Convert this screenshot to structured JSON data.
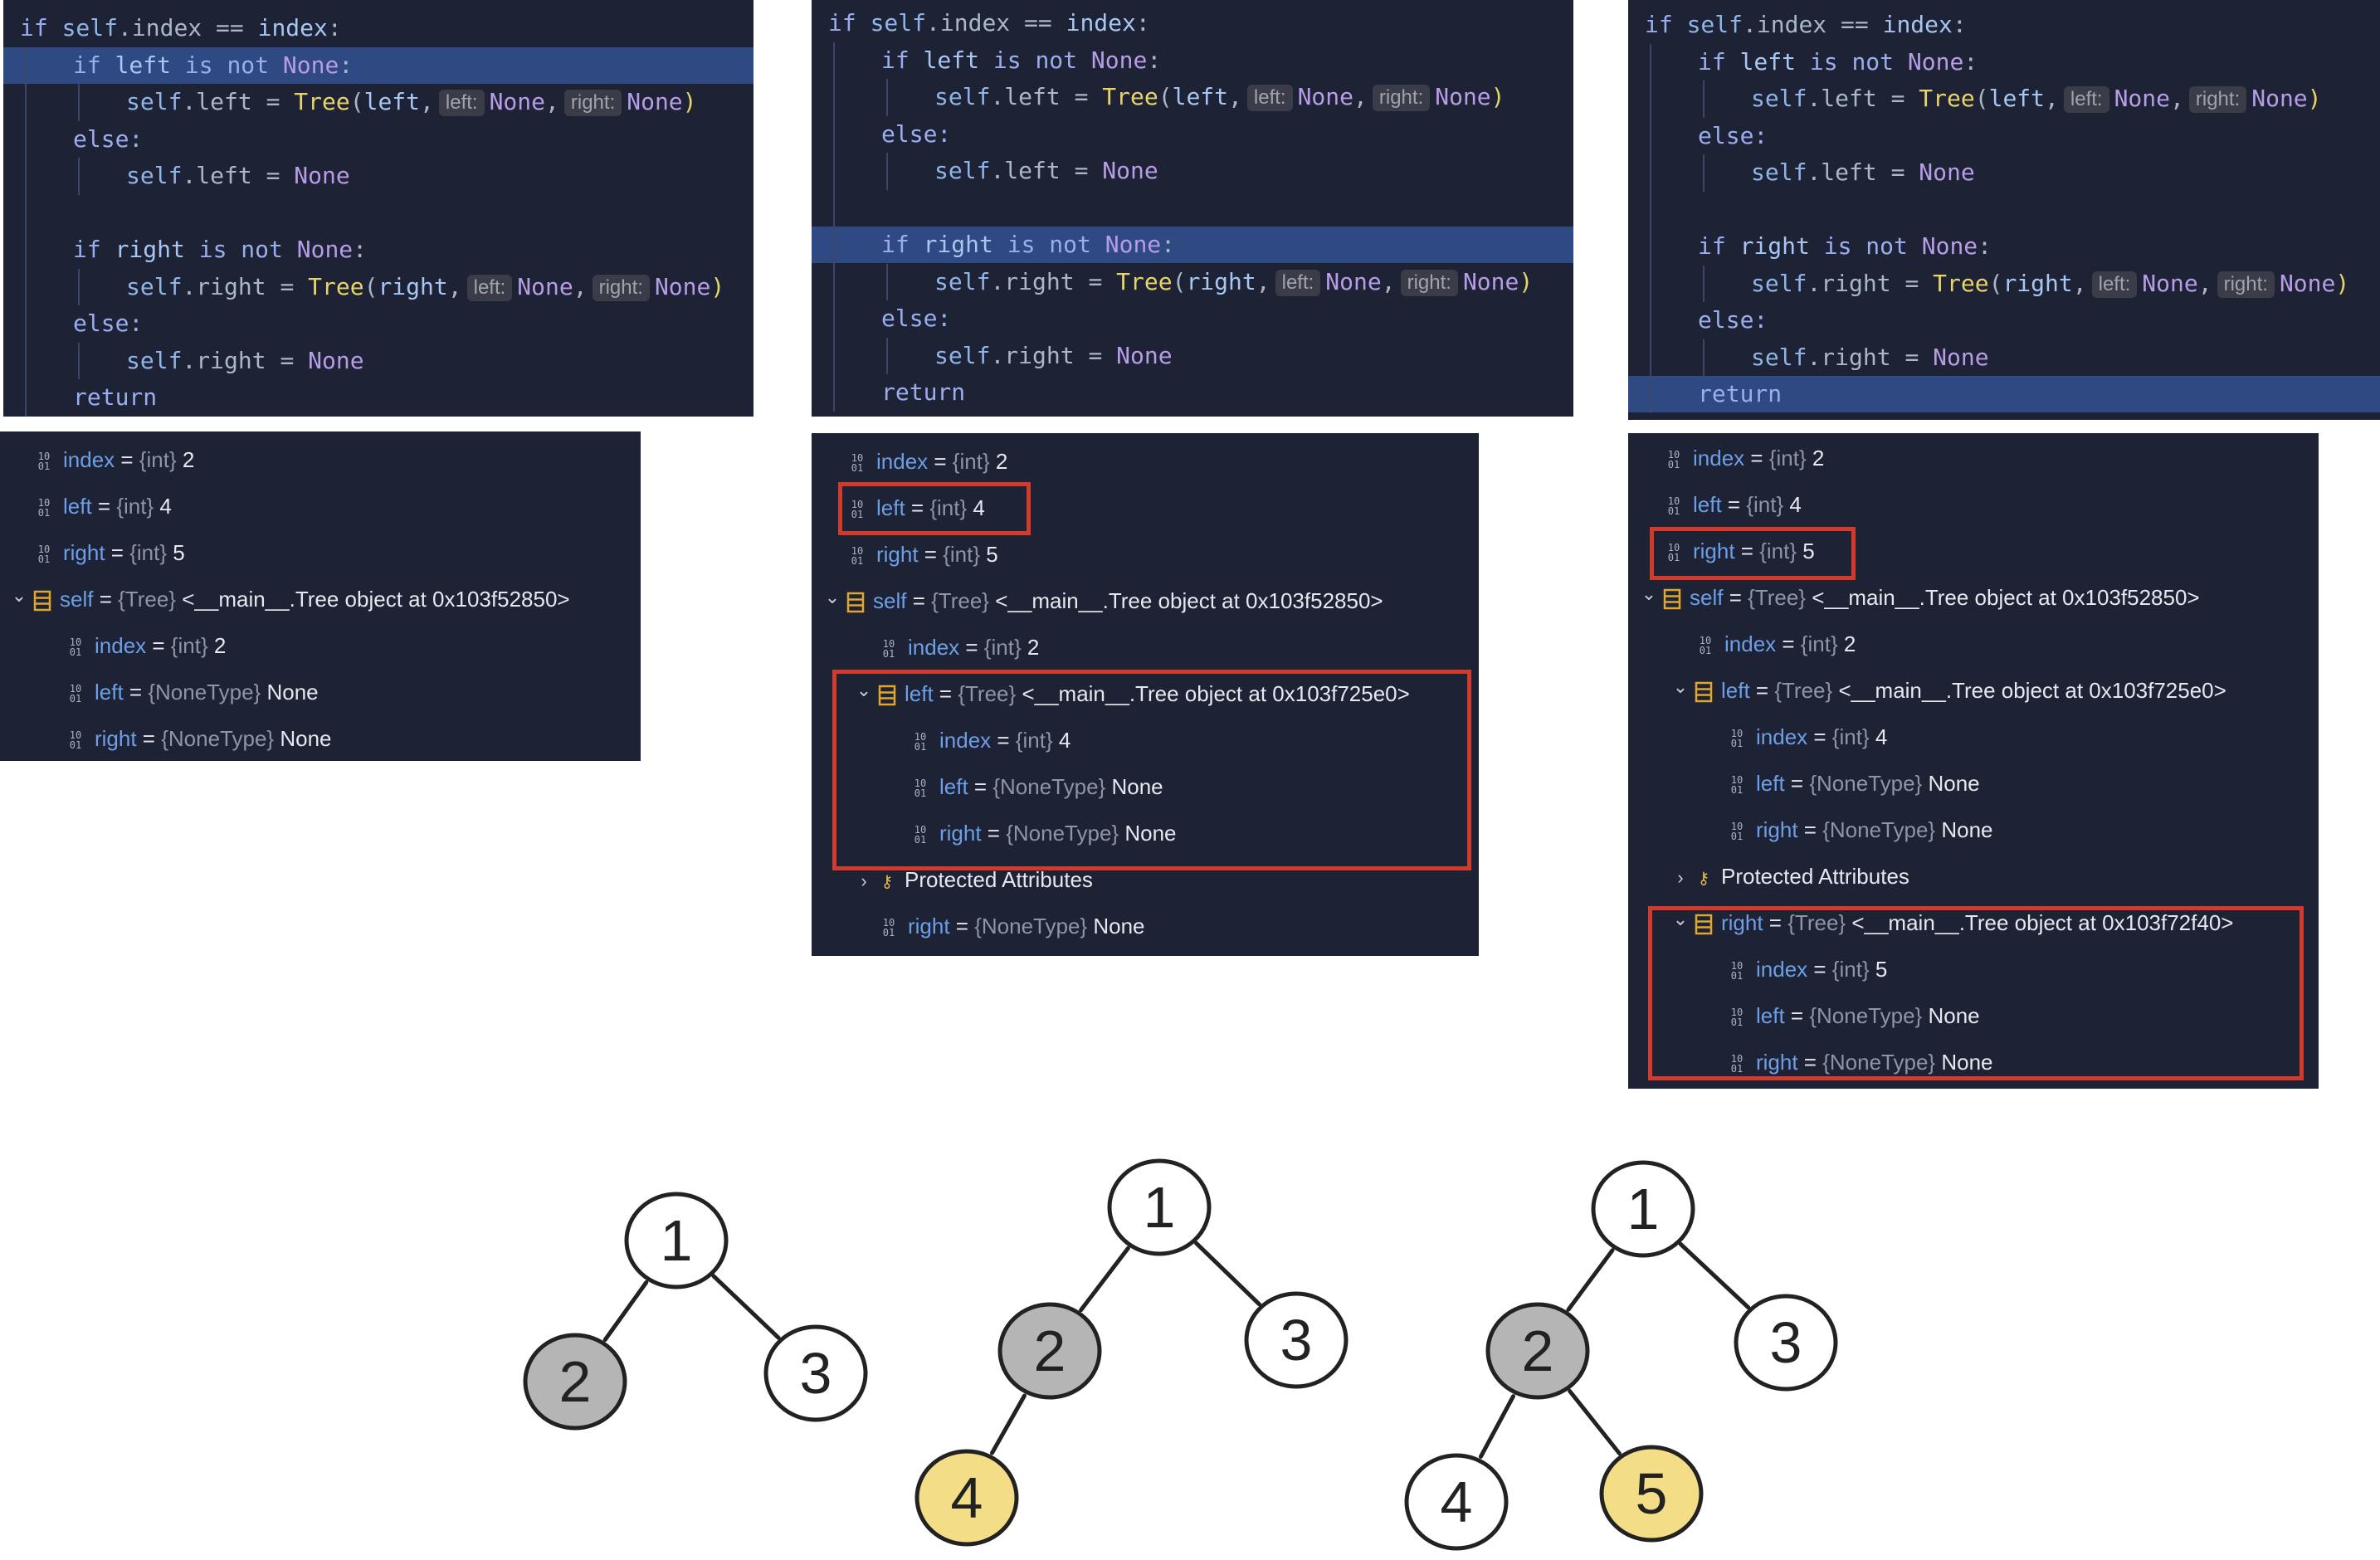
{
  "code_lines": {
    "if_index": [
      "if ",
      "self",
      ".index == ",
      "index",
      ":"
    ],
    "if_left": [
      "if ",
      "left",
      " is not ",
      "None",
      ":"
    ],
    "assign_left_tree": [
      "self",
      ".left = ",
      "Tree",
      "(",
      "left",
      ","
    ],
    "else": "else:",
    "assign_left_none": [
      "self",
      ".left = ",
      "None"
    ],
    "if_right": [
      "if ",
      "right",
      " is not ",
      "None",
      ":"
    ],
    "assign_right_tree": [
      "self",
      ".right = ",
      "Tree",
      "(",
      "right",
      ","
    ],
    "assign_right_none": [
      "self",
      ".right = ",
      "None"
    ],
    "return": "return",
    "hint_left": "left:",
    "hint_right": "right:",
    "hint_value": "None",
    "comma": ",",
    "close": ")"
  },
  "debug_panels": [
    {
      "highlighted_line": "if left is not None",
      "rows": [
        {
          "name": "index",
          "type": "{int}",
          "value": "2",
          "indent": 0,
          "icon": "binary-icon"
        },
        {
          "name": "left",
          "type": "{int}",
          "value": "4",
          "indent": 0,
          "icon": "binary-icon"
        },
        {
          "name": "right",
          "type": "{int}",
          "value": "5",
          "indent": 0,
          "icon": "binary-icon"
        },
        {
          "name": "self",
          "type": "{Tree}",
          "value": "<__main__.Tree object at 0x103f52850>",
          "indent": 0,
          "icon": "object-icon",
          "expanded": true
        },
        {
          "name": "index",
          "type": "{int}",
          "value": "2",
          "indent": 1,
          "icon": "binary-icon"
        },
        {
          "name": "left",
          "type": "{NoneType}",
          "value": "None",
          "indent": 1,
          "icon": "binary-icon"
        },
        {
          "name": "right",
          "type": "{NoneType}",
          "value": "None",
          "indent": 1,
          "icon": "binary-icon"
        }
      ]
    },
    {
      "highlighted_line": "if right is not None",
      "rows": [
        {
          "name": "index",
          "type": "{int}",
          "value": "2",
          "indent": 0,
          "icon": "binary-icon"
        },
        {
          "name": "left",
          "type": "{int}",
          "value": "4",
          "indent": 0,
          "icon": "binary-icon"
        },
        {
          "name": "right",
          "type": "{int}",
          "value": "5",
          "indent": 0,
          "icon": "binary-icon"
        },
        {
          "name": "self",
          "type": "{Tree}",
          "value": "<__main__.Tree object at 0x103f52850>",
          "indent": 0,
          "icon": "object-icon",
          "expanded": true
        },
        {
          "name": "index",
          "type": "{int}",
          "value": "2",
          "indent": 1,
          "icon": "binary-icon"
        },
        {
          "name": "left",
          "type": "{Tree}",
          "value": "<__main__.Tree object at 0x103f725e0>",
          "indent": 1,
          "icon": "object-icon",
          "expanded": true
        },
        {
          "name": "index",
          "type": "{int}",
          "value": "4",
          "indent": 2,
          "icon": "binary-icon"
        },
        {
          "name": "left",
          "type": "{NoneType}",
          "value": "None",
          "indent": 2,
          "icon": "binary-icon"
        },
        {
          "name": "right",
          "type": "{NoneType}",
          "value": "None",
          "indent": 2,
          "icon": "binary-icon"
        },
        {
          "name": "Protected Attributes",
          "type": "",
          "value": "",
          "indent": 1,
          "icon": "key-icon",
          "collapsed": true
        },
        {
          "name": "right",
          "type": "{NoneType}",
          "value": "None",
          "indent": 1,
          "icon": "binary-icon"
        }
      ]
    },
    {
      "highlighted_line": "return",
      "rows": [
        {
          "name": "index",
          "type": "{int}",
          "value": "2",
          "indent": 0,
          "icon": "binary-icon"
        },
        {
          "name": "left",
          "type": "{int}",
          "value": "4",
          "indent": 0,
          "icon": "binary-icon"
        },
        {
          "name": "right",
          "type": "{int}",
          "value": "5",
          "indent": 0,
          "icon": "binary-icon"
        },
        {
          "name": "self",
          "type": "{Tree}",
          "value": "<__main__.Tree object at 0x103f52850>",
          "indent": 0,
          "icon": "object-icon",
          "expanded": true
        },
        {
          "name": "index",
          "type": "{int}",
          "value": "2",
          "indent": 1,
          "icon": "binary-icon"
        },
        {
          "name": "left",
          "type": "{Tree}",
          "value": "<__main__.Tree object at 0x103f725e0>",
          "indent": 1,
          "icon": "object-icon",
          "expanded": true
        },
        {
          "name": "index",
          "type": "{int}",
          "value": "4",
          "indent": 2,
          "icon": "binary-icon"
        },
        {
          "name": "left",
          "type": "{NoneType}",
          "value": "None",
          "indent": 2,
          "icon": "binary-icon"
        },
        {
          "name": "right",
          "type": "{NoneType}",
          "value": "None",
          "indent": 2,
          "icon": "binary-icon"
        },
        {
          "name": "Protected Attributes",
          "type": "",
          "value": "",
          "indent": 1,
          "icon": "key-icon",
          "collapsed": true
        },
        {
          "name": "right",
          "type": "{Tree}",
          "value": "<__main__.Tree object at 0x103f72f40>",
          "indent": 1,
          "icon": "object-icon",
          "expanded": true
        },
        {
          "name": "index",
          "type": "{int}",
          "value": "5",
          "indent": 2,
          "icon": "binary-icon"
        },
        {
          "name": "left",
          "type": "{NoneType}",
          "value": "None",
          "indent": 2,
          "icon": "binary-icon"
        },
        {
          "name": "right",
          "type": "{NoneType}",
          "value": "None",
          "indent": 2,
          "icon": "binary-icon"
        }
      ]
    }
  ],
  "trees": [
    {
      "nodes": [
        {
          "label": "1",
          "state": "normal"
        },
        {
          "label": "2",
          "state": "visited"
        },
        {
          "label": "3",
          "state": "normal"
        }
      ]
    },
    {
      "nodes": [
        {
          "label": "1",
          "state": "normal"
        },
        {
          "label": "2",
          "state": "visited"
        },
        {
          "label": "3",
          "state": "normal"
        },
        {
          "label": "4",
          "state": "new"
        }
      ]
    },
    {
      "nodes": [
        {
          "label": "1",
          "state": "normal"
        },
        {
          "label": "2",
          "state": "visited"
        },
        {
          "label": "3",
          "state": "normal"
        },
        {
          "label": "4",
          "state": "normal"
        },
        {
          "label": "5",
          "state": "new"
        }
      ]
    }
  ],
  "colors": {
    "panel_bg": "#1e2235",
    "line_highlight": "#2f4a82",
    "red_box": "#d23a2c",
    "node_visited": "#b5b5b5",
    "node_new": "#f3dd86",
    "node_normal": "#ffffff"
  }
}
